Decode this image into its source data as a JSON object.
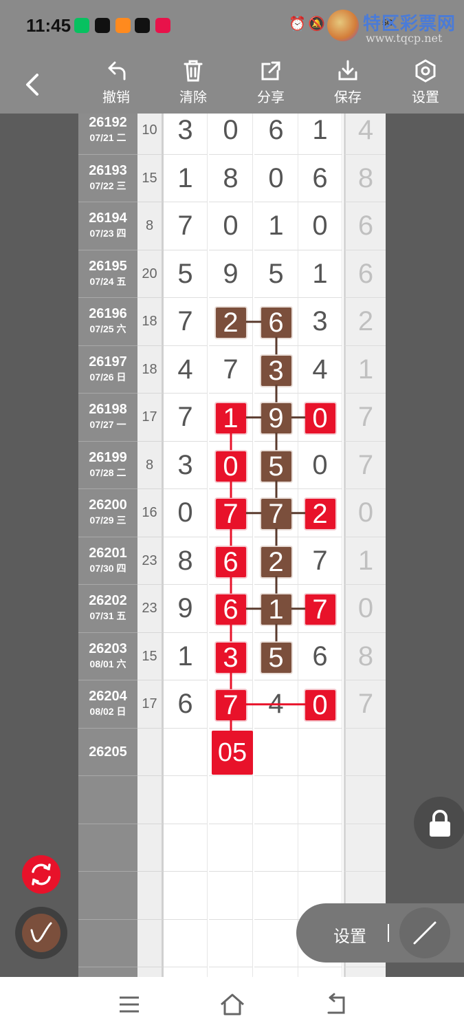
{
  "status_bar": {
    "time": "11:45",
    "apps": [
      {
        "icon": "wechat-icon",
        "color": "#07c160"
      },
      {
        "icon": "tiktok-icon",
        "color": "#111111"
      },
      {
        "icon": "video-app-icon",
        "color": "#ff8a1e"
      },
      {
        "icon": "qq-icon",
        "color": "#111111"
      },
      {
        "icon": "game-app-icon",
        "color": "#e8124a"
      }
    ],
    "network": "5G"
  },
  "watermark": {
    "title": "特区彩票网",
    "url": "www.tqcp.net"
  },
  "toolbar": {
    "undo_label": "撤销",
    "clear_label": "清除",
    "share_label": "分享",
    "save_label": "保存",
    "settings_label": "设置"
  },
  "rows": [
    {
      "issue": "26192",
      "date": "07/21 二",
      "sum": "10",
      "digits": [
        "3",
        "0",
        "6",
        "1"
      ],
      "last": "4"
    },
    {
      "issue": "26193",
      "date": "07/22 三",
      "sum": "15",
      "digits": [
        "1",
        "8",
        "0",
        "6"
      ],
      "last": "8"
    },
    {
      "issue": "26194",
      "date": "07/23 四",
      "sum": "8",
      "digits": [
        "7",
        "0",
        "1",
        "0"
      ],
      "last": "6"
    },
    {
      "issue": "26195",
      "date": "07/24 五",
      "sum": "20",
      "digits": [
        "5",
        "9",
        "5",
        "1"
      ],
      "last": "6"
    },
    {
      "issue": "26196",
      "date": "07/25 六",
      "sum": "18",
      "digits": [
        "7",
        "2",
        "6",
        "3"
      ],
      "last": "2"
    },
    {
      "issue": "26197",
      "date": "07/26 日",
      "sum": "18",
      "digits": [
        "4",
        "7",
        "3",
        "4"
      ],
      "last": "1"
    },
    {
      "issue": "26198",
      "date": "07/27 一",
      "sum": "17",
      "digits": [
        "7",
        "1",
        "9",
        "0"
      ],
      "last": "7"
    },
    {
      "issue": "26199",
      "date": "07/28 二",
      "sum": "8",
      "digits": [
        "3",
        "0",
        "5",
        "0"
      ],
      "last": "7"
    },
    {
      "issue": "26200",
      "date": "07/29 三",
      "sum": "16",
      "digits": [
        "0",
        "7",
        "7",
        "2"
      ],
      "last": "0"
    },
    {
      "issue": "26201",
      "date": "07/30 四",
      "sum": "23",
      "digits": [
        "8",
        "6",
        "2",
        "7"
      ],
      "last": "1"
    },
    {
      "issue": "26202",
      "date": "07/31 五",
      "sum": "23",
      "digits": [
        "9",
        "6",
        "1",
        "7"
      ],
      "last": "0"
    },
    {
      "issue": "26203",
      "date": "08/01 六",
      "sum": "15",
      "digits": [
        "1",
        "3",
        "5",
        "6"
      ],
      "last": "8"
    },
    {
      "issue": "26204",
      "date": "08/02 日",
      "sum": "17",
      "digits": [
        "6",
        "7",
        "4",
        "0"
      ],
      "last": "7"
    }
  ],
  "highlights": {
    "brown": [
      [
        4,
        1
      ],
      [
        4,
        2
      ],
      [
        5,
        2
      ],
      [
        6,
        2
      ],
      [
        7,
        2
      ],
      [
        8,
        2
      ],
      [
        9,
        2
      ],
      [
        10,
        2
      ],
      [
        11,
        2
      ]
    ],
    "red": [
      [
        6,
        1
      ],
      [
        6,
        3
      ],
      [
        7,
        1
      ],
      [
        8,
        1
      ],
      [
        8,
        3
      ],
      [
        9,
        1
      ],
      [
        10,
        1
      ],
      [
        10,
        3
      ],
      [
        11,
        1
      ],
      [
        12,
        1
      ],
      [
        12,
        3
      ]
    ],
    "colors": {
      "brown": "#7b4f3c",
      "red": "#e8122a"
    }
  },
  "next_issue": "26205",
  "prediction": "05",
  "floating_panel": {
    "label": "设置"
  }
}
